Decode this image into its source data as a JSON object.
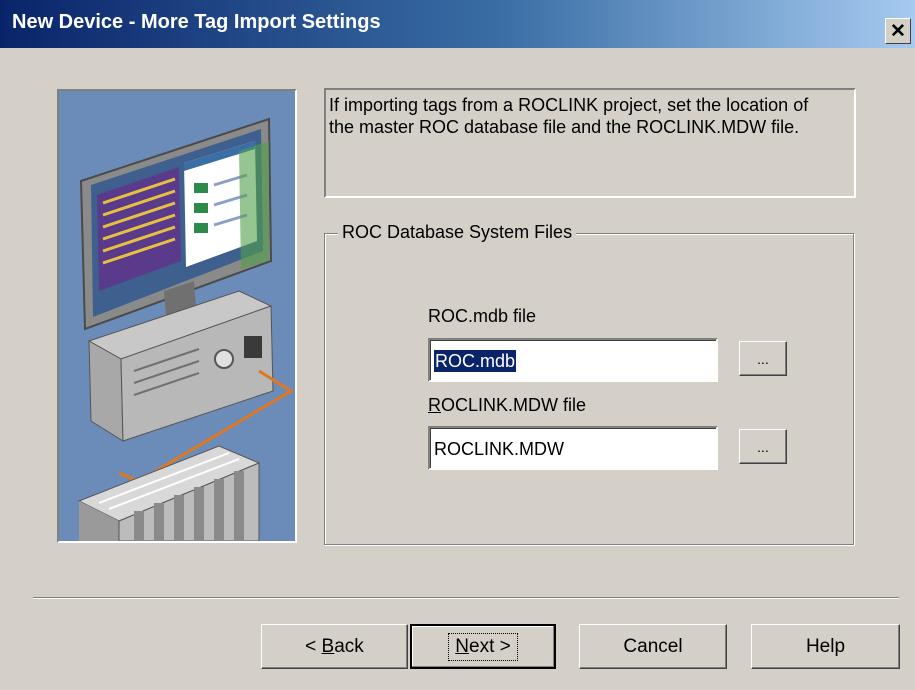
{
  "window": {
    "title": "New Device - More Tag Import Settings",
    "close_glyph": "✕"
  },
  "info": {
    "text": "If importing tags from a ROCLINK project, set the location of the master ROC database file and the ROCLINK.MDW file."
  },
  "group": {
    "legend": "ROC Database System Files",
    "roc_mdb": {
      "label": "ROC.mdb file",
      "value": "ROC.mdb",
      "browse_label": "..."
    },
    "roclink_mdw": {
      "label_mnemonic": "R",
      "label_rest": "OCLINK.MDW file",
      "value": "ROCLINK.MDW",
      "browse_label": "..."
    }
  },
  "buttons": {
    "back": {
      "prefix": "< ",
      "mnemonic": "B",
      "rest": "ack"
    },
    "next": {
      "mnemonic": "N",
      "rest": "ext >"
    },
    "cancel": "Cancel",
    "help": "Help"
  },
  "colors": {
    "title_gradient_start": "#0a246a",
    "title_gradient_end": "#a6caf0",
    "dialog_face": "#d4d0c8",
    "selection": "#0a246a"
  }
}
